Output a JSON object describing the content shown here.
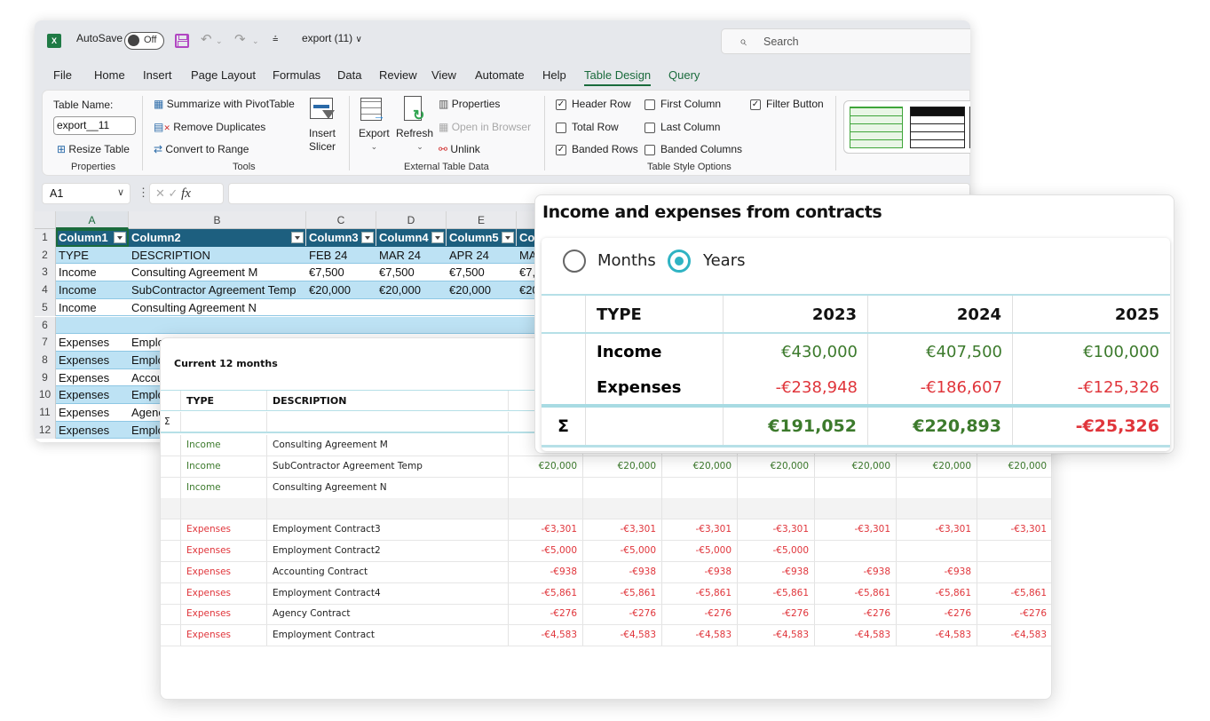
{
  "excel": {
    "title": {
      "autosave_label": "AutoSave",
      "autosave_state": "Off",
      "filename": "export (11)",
      "search_placeholder": "Search"
    },
    "menu": [
      "File",
      "Home",
      "Insert",
      "Page Layout",
      "Formulas",
      "Data",
      "Review",
      "View",
      "Automate",
      "Help",
      "Table Design",
      "Query"
    ],
    "active_menu": "Table Design",
    "ribbon": {
      "properties": {
        "table_name_label": "Table Name:",
        "table_name_value": "export__11",
        "resize_table": "Resize Table",
        "group_label": "Properties"
      },
      "tools": {
        "summarize_pivot": "Summarize with PivotTable",
        "remove_duplicates": "Remove Duplicates",
        "convert_to_range": "Convert to Range",
        "insert_slicer_1": "Insert",
        "insert_slicer_2": "Slicer",
        "group_label": "Tools"
      },
      "external": {
        "export": "Export",
        "refresh": "Refresh",
        "properties": "Properties",
        "open_in_browser": "Open in Browser",
        "unlink": "Unlink",
        "group_label": "External Table Data"
      },
      "style_options": {
        "header_row": {
          "label": "Header Row",
          "checked": true
        },
        "total_row": {
          "label": "Total Row",
          "checked": false
        },
        "banded_rows": {
          "label": "Banded Rows",
          "checked": true
        },
        "first_column": {
          "label": "First Column",
          "checked": false
        },
        "last_column": {
          "label": "Last Column",
          "checked": false
        },
        "banded_columns": {
          "label": "Banded Columns",
          "checked": false
        },
        "filter_button": {
          "label": "Filter Button",
          "checked": true
        },
        "group_label": "Table Style Options"
      }
    },
    "formula_bar": {
      "name_box": "A1",
      "fx": "fx",
      "formula": ""
    },
    "columns": [
      "A",
      "B",
      "C",
      "D",
      "E"
    ],
    "row_numbers": [
      "1",
      "2",
      "3",
      "4",
      "5",
      "6",
      "7",
      "8",
      "9",
      "10",
      "11",
      "12"
    ],
    "rows": [
      [
        "Column1",
        "Column2",
        "Column3",
        "Column4",
        "Column5",
        "Co"
      ],
      [
        "TYPE",
        "DESCRIPTION",
        "FEB 24",
        "MAR 24",
        "APR 24",
        "MA"
      ],
      [
        "Income",
        "Consulting Agreement M",
        "€7,500",
        "€7,500",
        "€7,500",
        "€7,"
      ],
      [
        "Income",
        "SubContractor Agreement Temp",
        "€20,000",
        "€20,000",
        "€20,000",
        "€20"
      ],
      [
        "Income",
        "Consulting Agreement N",
        "",
        "",
        "",
        ""
      ],
      [
        "",
        "",
        "",
        "",
        "",
        ""
      ],
      [
        "Expenses",
        "Emplo",
        "",
        "",
        "",
        ""
      ],
      [
        "Expenses",
        "Emplo",
        "",
        "",
        "",
        ""
      ],
      [
        "Expenses",
        "Accou",
        "",
        "",
        "",
        ""
      ],
      [
        "Expenses",
        "Emplo",
        "",
        "",
        "",
        ""
      ],
      [
        "Expenses",
        "Agenc",
        "",
        "",
        "",
        ""
      ],
      [
        "Expenses",
        "Emplo",
        "",
        "",
        "",
        ""
      ]
    ]
  },
  "panel12": {
    "title": "Current 12 months",
    "headers": [
      "TYPE",
      "DESCRIPTION"
    ],
    "sum_symbol": "Σ",
    "rows": [
      {
        "type": "Income",
        "desc": "Consulting Agreement M",
        "values": [
          "",
          "",
          "",
          "",
          "",
          "",
          ""
        ]
      },
      {
        "type": "Income",
        "desc": "SubContractor Agreement Temp",
        "values": [
          "€20,000",
          "€20,000",
          "€20,000",
          "€20,000",
          "€20,000",
          "€20,000",
          "€20,000"
        ]
      },
      {
        "type": "Income",
        "desc": "Consulting Agreement N",
        "values": [
          "",
          "",
          "",
          "",
          "",
          "",
          ""
        ]
      },
      {
        "type": "",
        "desc": "",
        "values": [
          "",
          "",
          "",
          "",
          "",
          "",
          ""
        ]
      },
      {
        "type": "Expenses",
        "desc": "Employment Contract3",
        "values": [
          "-€3,301",
          "-€3,301",
          "-€3,301",
          "-€3,301",
          "-€3,301",
          "-€3,301",
          "-€3,301"
        ]
      },
      {
        "type": "Expenses",
        "desc": "Employment Contract2",
        "values": [
          "-€5,000",
          "-€5,000",
          "-€5,000",
          "-€5,000",
          "",
          "",
          ""
        ]
      },
      {
        "type": "Expenses",
        "desc": "Accounting Contract",
        "values": [
          "-€938",
          "-€938",
          "-€938",
          "-€938",
          "-€938",
          "-€938",
          ""
        ]
      },
      {
        "type": "Expenses",
        "desc": "Employment Contract4",
        "values": [
          "-€5,861",
          "-€5,861",
          "-€5,861",
          "-€5,861",
          "-€5,861",
          "-€5,861",
          "-€5,861"
        ]
      },
      {
        "type": "Expenses",
        "desc": "Agency Contract",
        "values": [
          "-€276",
          "-€276",
          "-€276",
          "-€276",
          "-€276",
          "-€276",
          "-€276"
        ]
      },
      {
        "type": "Expenses",
        "desc": "Employment Contract",
        "values": [
          "-€4,583",
          "-€4,583",
          "-€4,583",
          "-€4,583",
          "-€4,583",
          "-€4,583",
          "-€4,583"
        ]
      }
    ]
  },
  "panelIE": {
    "title": "Income and expenses from contracts",
    "period_options": [
      {
        "label": "Months",
        "selected": false
      },
      {
        "label": "Years",
        "selected": true
      }
    ],
    "headers": [
      "TYPE",
      "2023",
      "2024",
      "2025"
    ],
    "income": {
      "label": "Income",
      "values": [
        "€430,000",
        "€407,500",
        "€100,000"
      ]
    },
    "expenses": {
      "label": "Expenses",
      "values": [
        "-€238,948",
        "-€186,607",
        "-€125,326"
      ]
    },
    "sum": {
      "symbol": "Σ",
      "values": [
        "€191,052",
        "€220,893",
        "-€25,326"
      ],
      "signs": [
        "positive",
        "positive",
        "negative"
      ]
    }
  },
  "colors": {
    "excel_green": "#1a6b3c",
    "table_header": "#1d5f7f",
    "table_band": "#bde2f4",
    "income_green": "#3c7a2c",
    "expense_red": "#e0353b",
    "accent_teal": "#2fb3c3"
  }
}
